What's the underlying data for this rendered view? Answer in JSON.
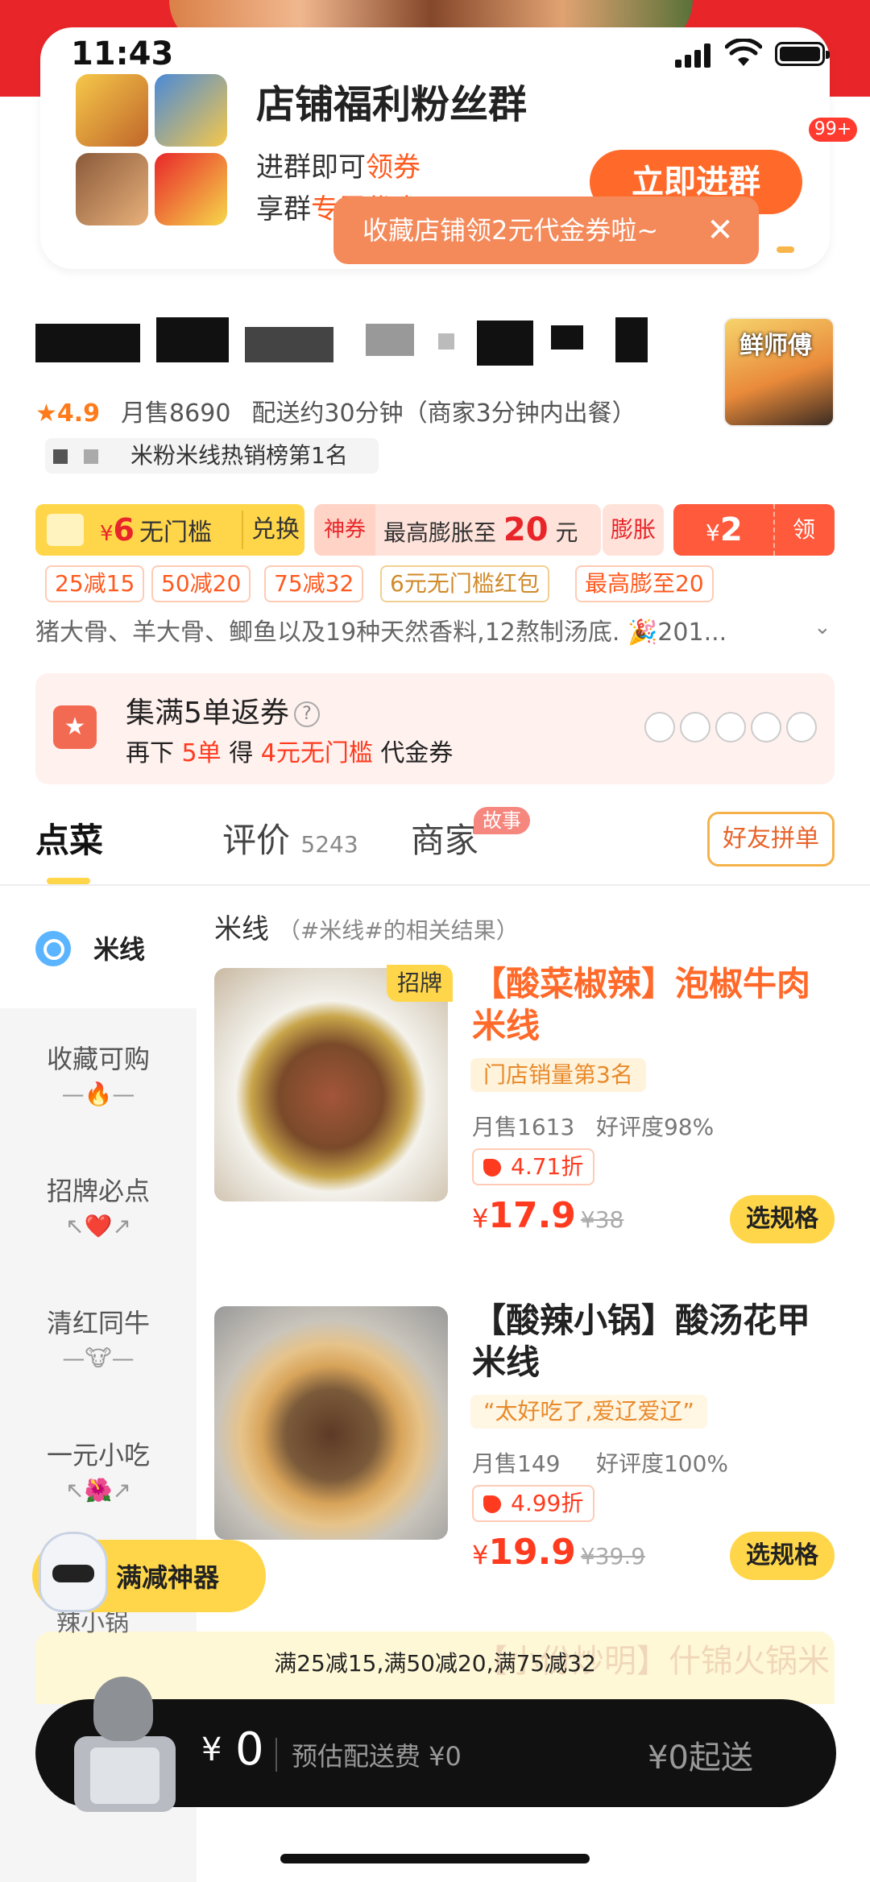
{
  "status_bar": {
    "time": "11:43"
  },
  "fan_group": {
    "title": "店铺福利粉丝群",
    "line1_prefix": "进群即可",
    "line1_highlight": "领券",
    "line2_prefix": "享群",
    "line2_highlight": "专属优惠",
    "join_label": "立即进群",
    "badge": "99+"
  },
  "toast": {
    "text": "收藏店铺领2元代金券啦~",
    "close": "✕"
  },
  "shop": {
    "logo_text": "鲜师傅",
    "rating": "4.9",
    "monthly_sales": "月售8690",
    "delivery": "配送约30分钟（商家3分钟内出餐）",
    "rank": "米粉米线热销榜第1名",
    "description": "猪大骨、羊大骨、鲫鱼以及19种天然香料,12熬制汤底. 🎉201..."
  },
  "coupons": {
    "c1_yen": "¥",
    "c1_amount": "6",
    "c1_label": "无门槛",
    "c1_action": "兑换",
    "c2_tag": "神券",
    "c2_prefix": "最高膨胀至",
    "c2_amount": "20",
    "c2_unit": "元",
    "c2_action": "膨胀",
    "c3_yen": "¥",
    "c3_amount": "2",
    "c3_action": "领"
  },
  "promos": [
    "25减15",
    "50减20",
    "75减32",
    "6元无门槛红包",
    "最高膨至20"
  ],
  "return_coupon": {
    "title": "集满5单返券",
    "help": "?",
    "sub_prefix": "再下",
    "sub_count": "5单",
    "sub_mid": "得",
    "sub_value": "4元无门槛",
    "sub_suffix": "代金券"
  },
  "tabs": {
    "order": "点菜",
    "reviews": "评价",
    "reviews_count": "5243",
    "merchant": "商家",
    "story_badge": "故事",
    "friend_order": "好友拼单"
  },
  "sidebar": {
    "search_label": "米线",
    "items": [
      {
        "label": "收藏可购",
        "emoji": "—🔥—"
      },
      {
        "label": "招牌必点",
        "emoji": "↖❤️↗"
      },
      {
        "label": "清红同牛",
        "emoji": "—🐮—"
      },
      {
        "label": "一元小吃",
        "emoji": "↖🌺↗"
      }
    ],
    "partial_item": "辣小锅"
  },
  "results": {
    "title": "米线",
    "note": "（#米线#的相关结果）"
  },
  "dishes": [
    {
      "badge": "招牌",
      "title": "【酸菜椒辣】泡椒牛肉米线",
      "tag": "门店销量第3名",
      "sales": "月售1613",
      "rating": "好评度98%",
      "discount": "4.71折",
      "yen": "¥",
      "price": "17.9",
      "original": "¥38",
      "button": "选规格"
    },
    {
      "title": "【酸辣小锅】酸汤花甲米线",
      "tag": "“太好吃了,爱辽爱辽”",
      "sales": "月售149",
      "rating": "好评度100%",
      "discount": "4.99折",
      "yen": "¥",
      "price": "19.9",
      "original": "¥39.9",
      "button": "选规格"
    }
  ],
  "third_dish_partial": "【小份炒明】什锦火锅米线+可乐+庭园",
  "assistant": {
    "label": "满减神器"
  },
  "manjian_bar": {
    "text": "满25减15,满50减20,满75减32"
  },
  "cart": {
    "yen": "¥",
    "amount": "0",
    "fee": "预估配送费 ¥0",
    "min_order": "¥0起送"
  },
  "colors": {
    "brand_yellow": "#ffd64a",
    "accent_red": "#ff3b1f",
    "orange": "#ff6a2a"
  }
}
